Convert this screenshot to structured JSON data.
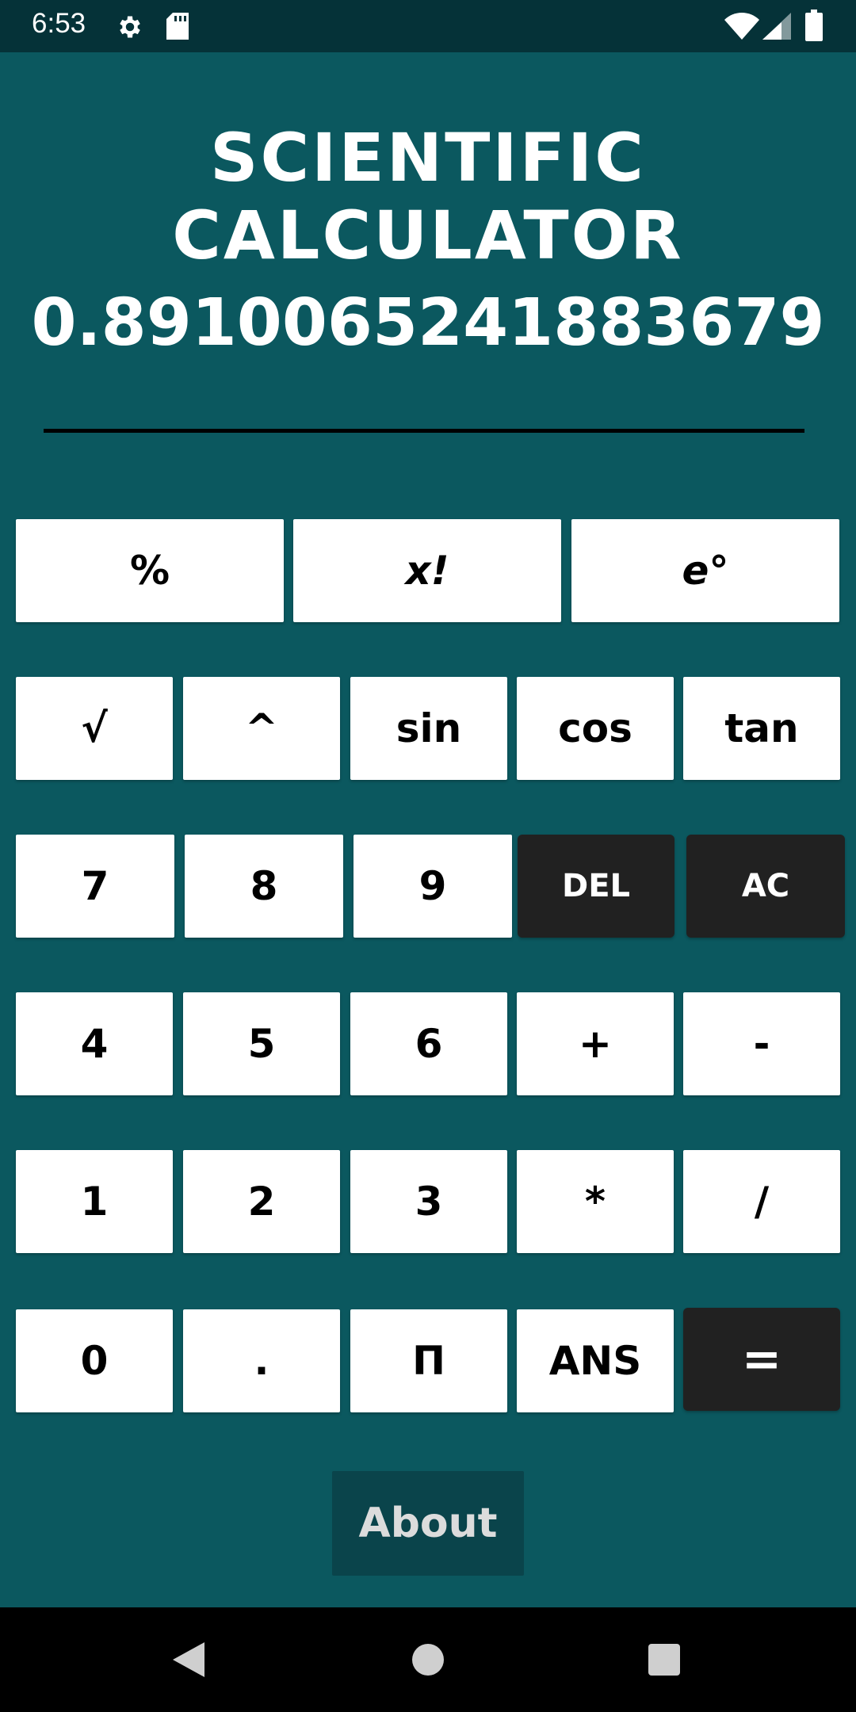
{
  "status_bar": {
    "time": "6:53",
    "icons": [
      "gear-icon",
      "sd-card-icon",
      "wifi-icon",
      "signal-icon",
      "battery-icon"
    ]
  },
  "app": {
    "title": "SCIENTIFIC  CALCULATOR",
    "display": "0.8910065241883679"
  },
  "keys": {
    "row1": [
      "%",
      "x!",
      "e°"
    ],
    "row2": [
      "√",
      "^",
      "sin",
      "cos",
      "tan"
    ],
    "row3": [
      "7",
      "8",
      "9",
      "DEL",
      "AC"
    ],
    "row4": [
      "4",
      "5",
      "6",
      "+",
      "-"
    ],
    "row5": [
      "1",
      "2",
      "3",
      "*",
      "/"
    ],
    "row6": [
      "0",
      ".",
      "Π",
      "ANS",
      "="
    ]
  },
  "about_label": "About",
  "colors": {
    "background": "#0B585F",
    "status_bar": "#053238",
    "key_light": "#FFFFFF",
    "key_dark": "#212121",
    "about_button": "#0A444B"
  },
  "nav_bar": {
    "icons": [
      "back-icon",
      "home-icon",
      "recents-icon"
    ]
  }
}
